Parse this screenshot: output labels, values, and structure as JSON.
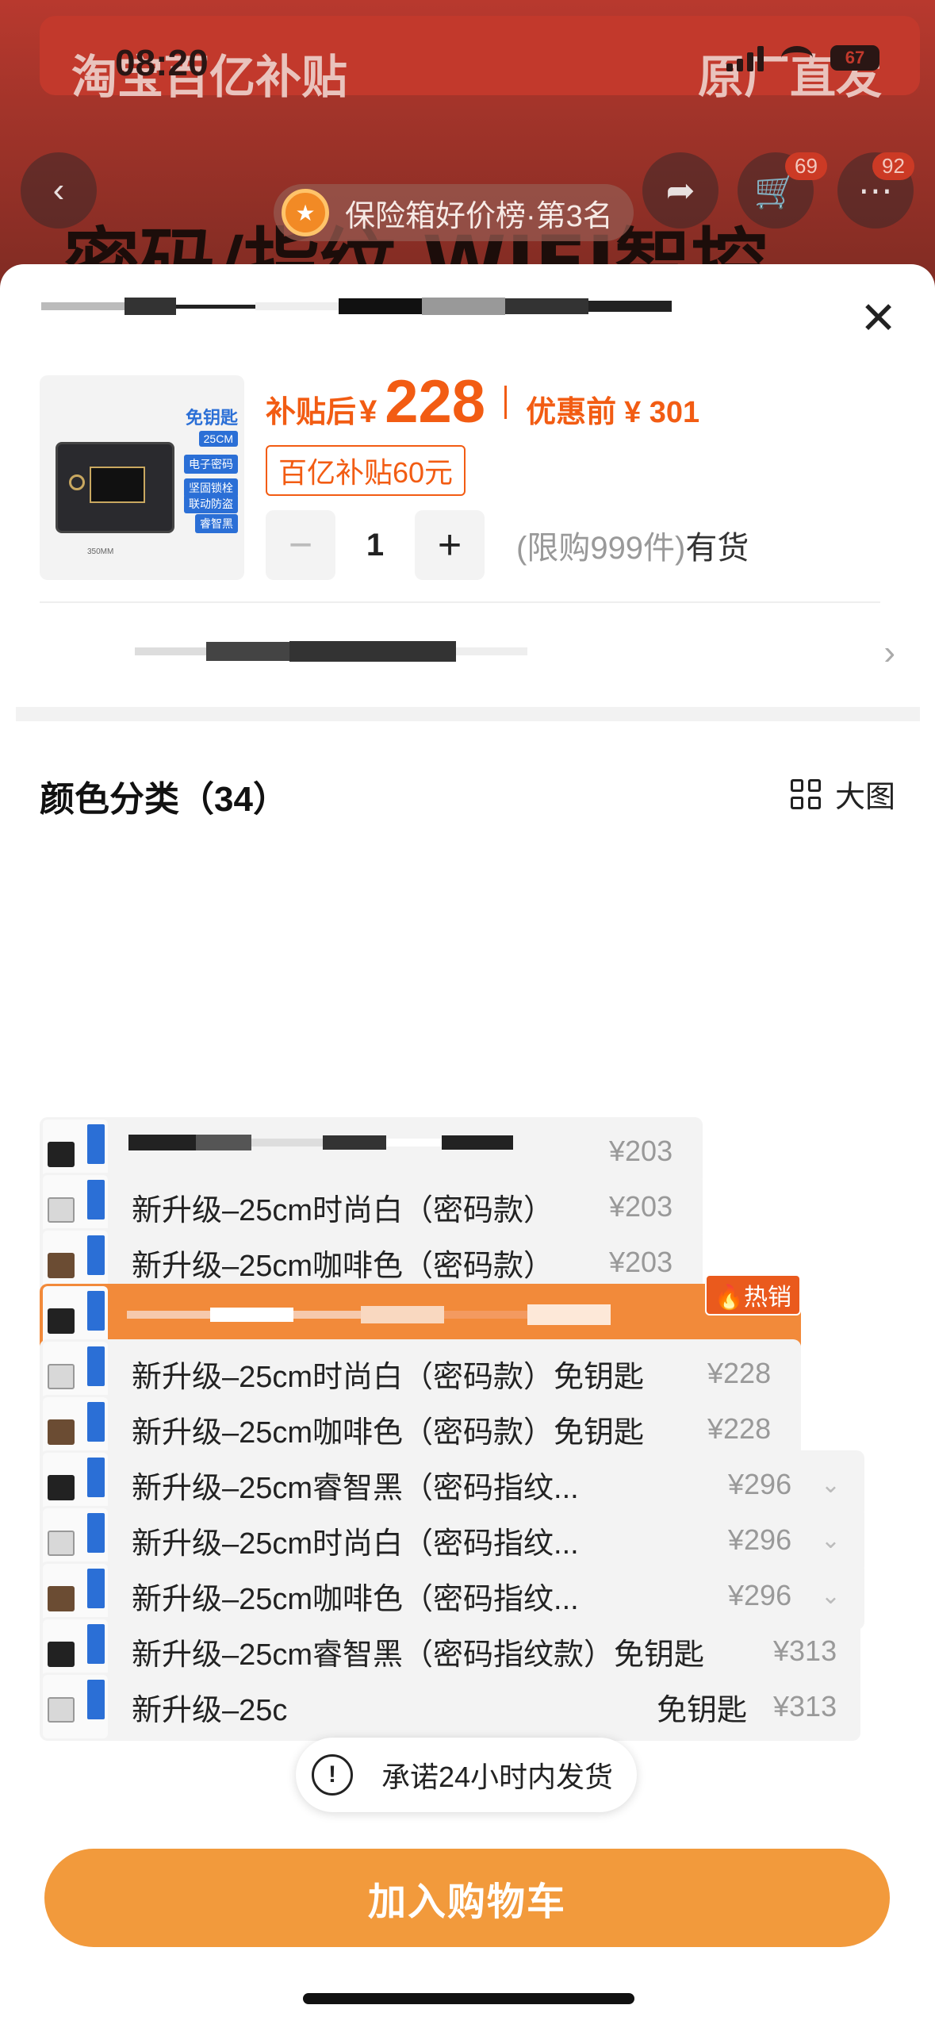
{
  "status_bar": {
    "time": "08:20",
    "battery": "67"
  },
  "background": {
    "banner_left": "淘宝百亿补贴",
    "banner_right": "原厂直发",
    "headline": "密码/指纹 WIFI智控",
    "cart_badge": "69",
    "more_badge": "92"
  },
  "ranking": {
    "label": "保险箱好价榜·第3名"
  },
  "product": {
    "image_title": "免钥匙",
    "image_size_tag": "25CM",
    "image_tags": [
      "电子密码",
      "坚固锁栓",
      "联动防盗",
      "睿智黑"
    ],
    "image_dim": "350MM",
    "price_label": "补贴后",
    "currency": "¥",
    "price": "228",
    "price_before_label": "优惠前",
    "price_before": "¥ 301",
    "subsidy_tag": "百亿补贴60元",
    "quantity": "1",
    "limit_text": "(限购999件)",
    "stock_text": "有货"
  },
  "section": {
    "title": "颜色分类（34）",
    "big_view_label": "大图"
  },
  "options": [
    {
      "label": "",
      "price": "¥203",
      "color": "#222222"
    },
    {
      "label": "新升级–25cm时尚白（密码款）",
      "price": "¥203",
      "color": "#d8d8d8"
    },
    {
      "label": "新升级–25cm咖啡色（密码款）",
      "price": "¥203",
      "color": "#6b4c33"
    },
    {
      "label": "",
      "price": "",
      "color": "#222222",
      "selected": true,
      "badge": "热销"
    },
    {
      "label": "新升级–25cm时尚白（密码款）免钥匙",
      "price": "¥228",
      "color": "#d8d8d8"
    },
    {
      "label": "新升级–25cm咖啡色（密码款）免钥匙",
      "price": "¥228",
      "color": "#6b4c33"
    },
    {
      "label": "新升级–25cm睿智黑（密码指纹...",
      "price": "¥296",
      "color": "#222222"
    },
    {
      "label": "新升级–25cm时尚白（密码指纹...",
      "price": "¥296",
      "color": "#d8d8d8"
    },
    {
      "label": "新升级–25cm咖啡色（密码指纹...",
      "price": "¥296",
      "color": "#6b4c33"
    },
    {
      "label": "新升级–25cm睿智黑（密码指纹款）免钥匙",
      "price": "¥313",
      "color": "#222222"
    },
    {
      "label": "新升级–25c",
      "label_tail": "免钥匙",
      "price": "¥313",
      "color": "#d8d8d8"
    }
  ],
  "toast": {
    "text": "承诺24小时内发货"
  },
  "cart_button": {
    "label": "加入购物车"
  },
  "colors": {
    "accent": "#f25c13",
    "cart_button": "#f29a3c",
    "selected_option": "#f28a3a"
  }
}
